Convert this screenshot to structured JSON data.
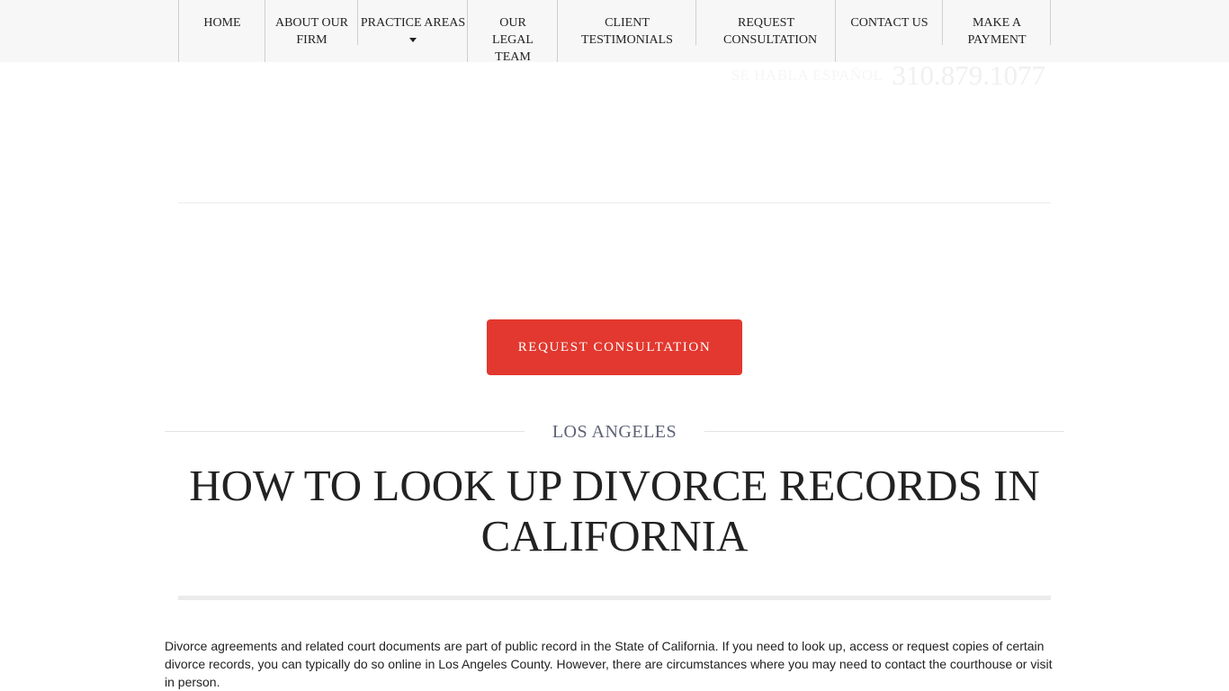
{
  "nav": {
    "items": [
      {
        "label": "HOME"
      },
      {
        "label": "ABOUT OUR FIRM"
      },
      {
        "label": "PRACTICE AREAS",
        "has_dropdown": true
      },
      {
        "label": "OUR LEGAL TEAM"
      },
      {
        "label": "CLIENT TESTIMONIALS"
      },
      {
        "label": "REQUEST CONSULTATION"
      },
      {
        "label": "CONTACT US"
      },
      {
        "label": "MAKE A PAYMENT"
      }
    ]
  },
  "header": {
    "spanish_text": "SE HABLA ESPAÑOL",
    "phone": "310.879.1077"
  },
  "cta": {
    "label": "REQUEST CONSULTATION",
    "color": "#e2382f"
  },
  "article": {
    "eyebrow": "LOS ANGELES",
    "title": "HOW TO LOOK UP DIVORCE RECORDS IN CALIFORNIA",
    "intro": "Divorce agreements and related court documents are part of public record in the State of California. If you need to look up, access or request copies of certain divorce records, you can typically do so online in Los Angeles County. However, there are circumstances where you may need to contact the courthouse or visit in person."
  },
  "icons": {
    "dropdown": "caret-down-icon"
  }
}
